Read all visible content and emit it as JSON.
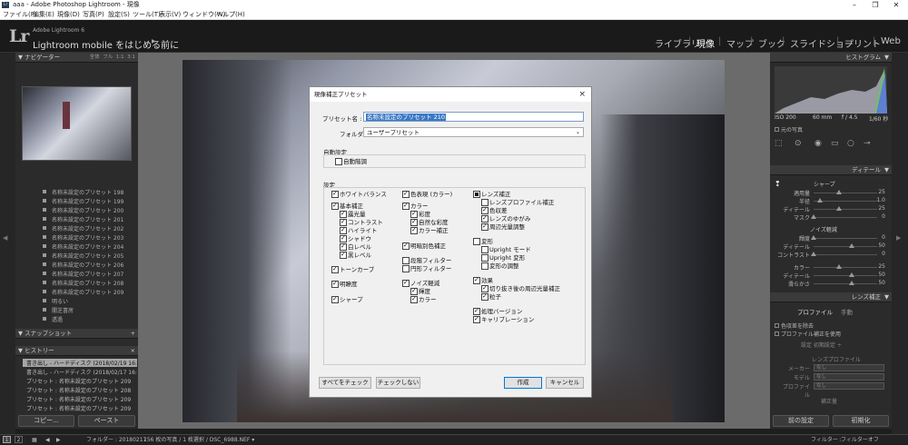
{
  "window": {
    "title": "aaa - Adobe Photoshop Lightroom - 現像"
  },
  "menu": [
    "ファイル(F)",
    "編集(E)",
    "現像(D)",
    "写真(P)",
    "設定(S)",
    "ツール(T)",
    "表示(V)",
    "ウィンドウ(W)",
    "ヘルプ(H)"
  ],
  "identity": {
    "logo": "Lr",
    "product": "Adobe Lightroom 6",
    "tagline": "Lightroom mobile をはじめる前に"
  },
  "modules": [
    "ライブラリ",
    "現像",
    "マップ",
    "ブック",
    "スライドショー",
    "プリント",
    "Web"
  ],
  "left_panel": {
    "navigator": {
      "title": "ナビゲーター",
      "modes": [
        "全体",
        "フル",
        "1:1",
        "3:1"
      ]
    },
    "presets": [
      "名称未設定のプリセット 198",
      "名称未設定のプリセット 199",
      "名称未設定のプリセット 200",
      "名称未設定のプリセット 201",
      "名称未設定のプリセット 202",
      "名称未設定のプリセット 203",
      "名称未設定のプリセット 204",
      "名称未設定のプリセット 205",
      "名称未設定のプリセット 206",
      "名称未設定のプリセット 207",
      "名称未設定のプリセット 208",
      "名称未設定のプリセット 209",
      "明るい",
      "闇芝書房",
      "透過"
    ],
    "snapshots": {
      "title": "スナップショット",
      "add": "+"
    },
    "history": {
      "title": "ヒストリー",
      "close": "×",
      "items": [
        "書き出し - ハードディスク (2018/02/19 16:2...",
        "書き出し - ハードディスク (2018/02/17 16:5...",
        "プリセット : 名称未設定のプリセット 209",
        "プリセット : 名称未設定のプリセット 208",
        "プリセット : 名称未設定のプリセット 209",
        "プリセット : 名称未設定のプリセット 209"
      ]
    },
    "copy": "コピー...",
    "paste": "ペースト"
  },
  "right_panel": {
    "histogram": {
      "title": "ヒストグラム",
      "iso": "ISO 200",
      "focal": "60 mm",
      "aperture": "f / 4.5",
      "shutter": "1/60 秒",
      "original": "元の写真"
    },
    "detail": {
      "title": "ディテール",
      "sharpen": "シャープ",
      "sharp_rows": [
        {
          "label": "適用量",
          "value": "25"
        },
        {
          "label": "半径",
          "value": "1.0"
        },
        {
          "label": "ディテール",
          "value": "25"
        },
        {
          "label": "マスク",
          "value": "0"
        }
      ],
      "noise": "ノイズ軽減",
      "noise_rows": [
        {
          "label": "輝度",
          "value": "0"
        },
        {
          "label": "ディテール",
          "value": "50"
        },
        {
          "label": "コントラスト",
          "value": "0"
        }
      ],
      "color_rows": [
        {
          "label": "カラー",
          "value": "25"
        },
        {
          "label": "ディテール",
          "value": "50"
        },
        {
          "label": "滑らかさ",
          "value": "50"
        }
      ]
    },
    "lens": {
      "title": "レンズ補正",
      "tabs": [
        "プロファイル",
        "手動"
      ],
      "chk1": "色収差を除去",
      "chk2": "プロファイル補正を使用",
      "setup_label": "設定",
      "setup_value": "初期設定 ÷",
      "profile": "レンズプロファイル",
      "maker_label": "メーカー",
      "maker": "なし",
      "model_label": "モデル",
      "model": "なし",
      "prof_label": "プロファイル",
      "prof": "なし",
      "amount": "補正量"
    },
    "prev": "前の設定",
    "reset": "初期化"
  },
  "filmstrip": {
    "pages": [
      "1",
      "2"
    ],
    "folder": "フォルダー : 20180217",
    "count": "156 枚の写真 / 1 枚選択 / DSC_6988.NEF ▾",
    "filter": "フィルター :",
    "filter_value": "フィルターオフ"
  },
  "dialog": {
    "title": "現像補正プリセット",
    "close": "×",
    "name_label": "プリセット名 :",
    "name_value": "名称未設定のプリセット 210",
    "folder_label": "フォルダー :",
    "folder_value": "ユーザープリセット",
    "auto_title": "自動設定",
    "auto_tone": "自動階調",
    "settings_title": "設定",
    "col1": [
      {
        "label": "ホワイトバランス",
        "state": "on",
        "indent": 0
      },
      {
        "label": "基本補正",
        "state": "on",
        "indent": 0
      },
      {
        "label": "露光量",
        "state": "on",
        "indent": 1
      },
      {
        "label": "コントラスト",
        "state": "on",
        "indent": 1
      },
      {
        "label": "ハイライト",
        "state": "on",
        "indent": 1
      },
      {
        "label": "シャドウ",
        "state": "on",
        "indent": 1
      },
      {
        "label": "白レベル",
        "state": "on",
        "indent": 1
      },
      {
        "label": "黒レベル",
        "state": "on",
        "indent": 1
      },
      {
        "label": "トーンカーブ",
        "state": "on",
        "indent": 0
      },
      {
        "label": "明瞭度",
        "state": "on",
        "indent": 0
      },
      {
        "label": "シャープ",
        "state": "on",
        "indent": 0
      }
    ],
    "col2": [
      {
        "label": "色表現 (カラー)",
        "state": "on",
        "indent": 0
      },
      {
        "label": "カラー",
        "state": "on",
        "indent": 0
      },
      {
        "label": "彩度",
        "state": "on",
        "indent": 1
      },
      {
        "label": "自然な彩度",
        "state": "on",
        "indent": 1
      },
      {
        "label": "カラー補正",
        "state": "on",
        "indent": 1
      },
      {
        "label": "明暗別色補正",
        "state": "on",
        "indent": 0
      },
      {
        "label": "段階フィルター",
        "state": "off",
        "indent": 0
      },
      {
        "label": "円形フィルター",
        "state": "off",
        "indent": 0
      },
      {
        "label": "ノイズ軽減",
        "state": "on",
        "indent": 0
      },
      {
        "label": "輝度",
        "state": "on",
        "indent": 1
      },
      {
        "label": "カラー",
        "state": "on",
        "indent": 1
      }
    ],
    "col3": [
      {
        "label": "レンズ補正",
        "state": "part",
        "indent": 0
      },
      {
        "label": "レンズプロファイル補正",
        "state": "off",
        "indent": 1
      },
      {
        "label": "色収差",
        "state": "on",
        "indent": 1
      },
      {
        "label": "レンズのゆがみ",
        "state": "on",
        "indent": 1
      },
      {
        "label": "周辺光量調整",
        "state": "on",
        "indent": 1
      },
      {
        "label": "変形",
        "state": "off",
        "indent": 0
      },
      {
        "label": "Upright モード",
        "state": "off",
        "indent": 1
      },
      {
        "label": "Upright 変形",
        "state": "off",
        "indent": 1
      },
      {
        "label": "変形の調整",
        "state": "off",
        "indent": 1
      },
      {
        "label": "効果",
        "state": "on",
        "indent": 0
      },
      {
        "label": "切り抜き後の周辺光量補正",
        "state": "on",
        "indent": 1
      },
      {
        "label": "粒子",
        "state": "on",
        "indent": 1
      },
      {
        "label": "処理バージョン",
        "state": "on",
        "indent": 0
      },
      {
        "label": "キャリブレーション",
        "state": "on",
        "indent": 0
      }
    ],
    "check_all": "すべてをチェック",
    "check_none": "チェックしない",
    "create": "作成",
    "cancel": "キャンセル"
  }
}
